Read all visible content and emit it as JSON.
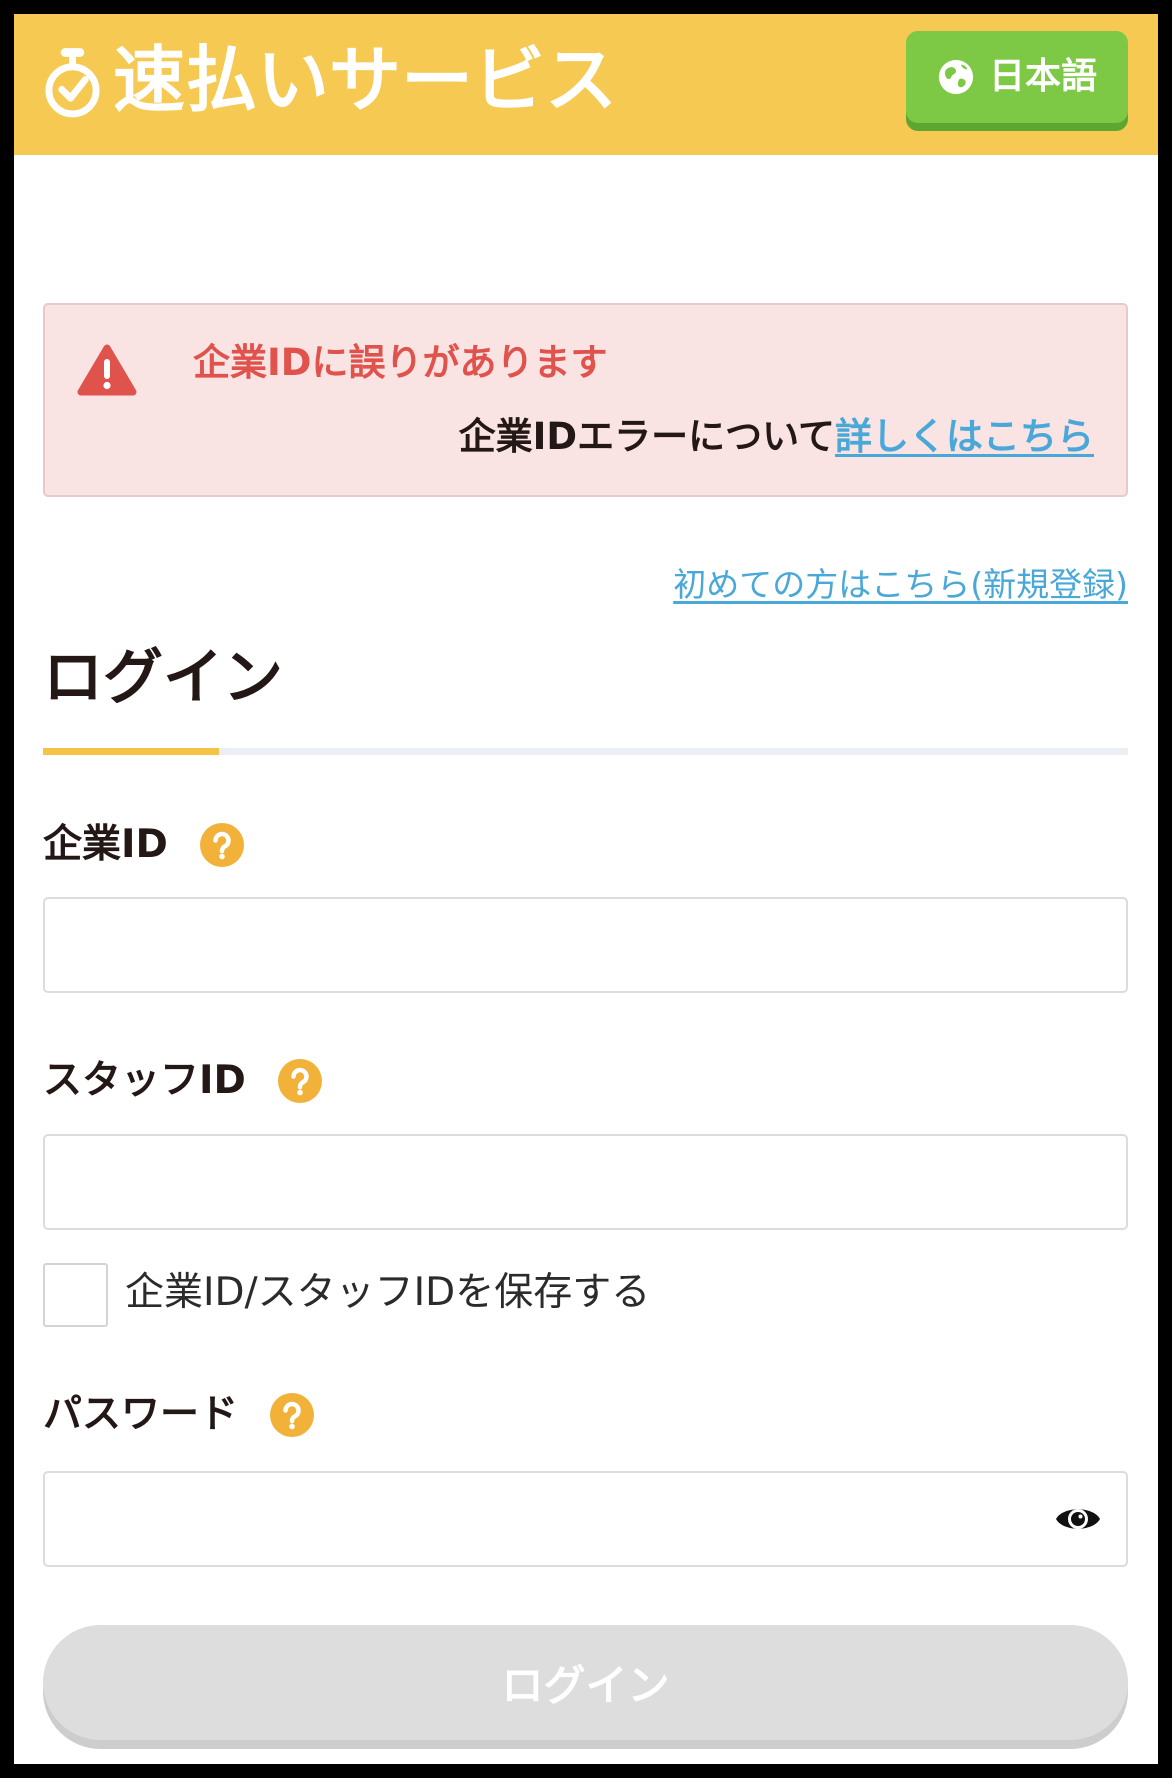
{
  "header": {
    "logo_icon": "stopwatch-icon",
    "logo_text": "速払いサービス",
    "language_icon": "globe-icon",
    "language_label": "日本語"
  },
  "alert": {
    "icon": "warning-icon",
    "title": "企業IDに誤りがあります",
    "detail_text": "企業IDエラーについて",
    "detail_link": "詳しくはこちら"
  },
  "register_link": "初めての方はこちら(新規登録)",
  "login": {
    "title": "ログイン",
    "fields": {
      "company_id": {
        "label": "企業ID",
        "value": "",
        "help_icon": "question-icon"
      },
      "staff_id": {
        "label": "スタッフID",
        "value": "",
        "help_icon": "question-icon"
      },
      "password": {
        "label": "パスワード",
        "value": "",
        "help_icon": "question-icon",
        "toggle_icon": "eye-icon"
      }
    },
    "remember_ids": {
      "label": "企業ID/スタッフIDを保存する",
      "checked": false
    },
    "submit": {
      "label": "ログイン",
      "enabled": false
    }
  },
  "colors": {
    "header": "#F5C952",
    "lang-button": "#7DC945",
    "error-red": "#E0534C",
    "link-blue": "#4AA8D8",
    "help-icon": "#F2B23A",
    "tab-accent": "#F5C445",
    "disabled-button": "#DDDDDD"
  }
}
